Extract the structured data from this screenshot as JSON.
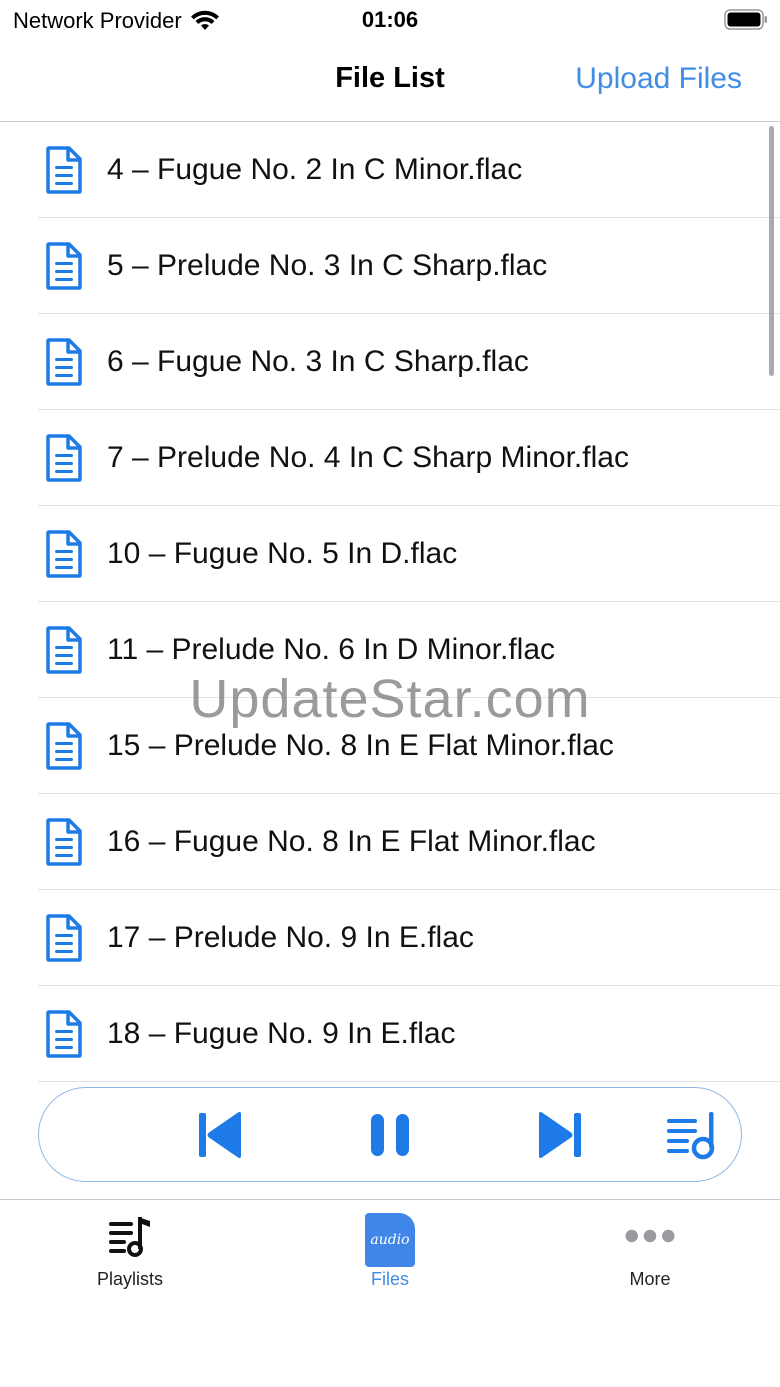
{
  "status_bar": {
    "carrier": "Network Provider",
    "time": "01:06",
    "wifi_icon": "wifi-icon",
    "battery_icon": "battery-icon"
  },
  "nav": {
    "title": "File List",
    "action_label": "Upload Files"
  },
  "files": [
    {
      "name": "4 – Fugue No. 2 In C Minor.flac",
      "icon": "document-icon"
    },
    {
      "name": "5 – Prelude No. 3 In C Sharp.flac",
      "icon": "document-icon"
    },
    {
      "name": "6 – Fugue No. 3 In C Sharp.flac",
      "icon": "document-icon"
    },
    {
      "name": "7 – Prelude No. 4 In C Sharp Minor.flac",
      "icon": "document-icon"
    },
    {
      "name": "10 – Fugue No. 5 In D.flac",
      "icon": "document-icon"
    },
    {
      "name": "11 – Prelude No. 6 In D Minor.flac",
      "icon": "document-icon"
    },
    {
      "name": "15 – Prelude No. 8 In E Flat Minor.flac",
      "icon": "document-icon"
    },
    {
      "name": "16 – Fugue No. 8 In E Flat Minor.flac",
      "icon": "document-icon"
    },
    {
      "name": "17 – Prelude No. 9 In E.flac",
      "icon": "document-icon"
    },
    {
      "name": "18 – Fugue No. 9 In E.flac",
      "icon": "document-icon"
    }
  ],
  "watermark": "UpdateStar.com",
  "player": {
    "controls": [
      "previous-track-icon",
      "pause-icon",
      "next-track-icon",
      "queue-icon"
    ]
  },
  "tabs": [
    {
      "label": "Playlists",
      "icon": "playlist-icon",
      "active": false
    },
    {
      "label": "Files",
      "icon": "audio-file-icon",
      "icon_text": "audio",
      "active": true
    },
    {
      "label": "More",
      "icon": "more-icon",
      "active": false
    }
  ],
  "colors": {
    "accent": "#3f8de6",
    "icon_blue": "#1e7ae6",
    "separator": "#e3e3e6"
  }
}
